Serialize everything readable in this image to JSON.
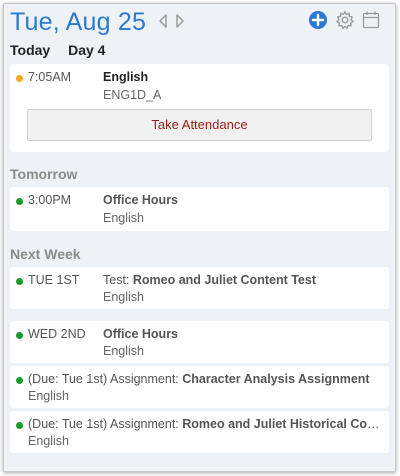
{
  "header": {
    "date_title": "Tue, Aug 25",
    "colors": {
      "accent": "#2a7bd1",
      "icon_gray": "#9a9a9a"
    }
  },
  "today": {
    "label": "Today",
    "day_label": "Day 4",
    "event": {
      "dot_color": "#f5a623",
      "time": "7:05AM",
      "title": "English",
      "subtitle": "ENG1D_A",
      "action_label": "Take Attendance"
    }
  },
  "tomorrow": {
    "label": "Tomorrow",
    "event": {
      "dot_color": "#1a9a2c",
      "time": "3:00PM",
      "title": "Office Hours",
      "subtitle": "English"
    }
  },
  "next_week": {
    "label": "Next Week",
    "events": [
      {
        "dot_color": "#1a9a2c",
        "time": "TUE 1ST",
        "prefix": "Test: ",
        "title": "Romeo and Juliet Content Test",
        "subtitle": "English"
      },
      {
        "dot_color": "#1a9a2c",
        "time": "WED 2ND",
        "prefix": "",
        "title": "Office Hours",
        "subtitle": "English"
      },
      {
        "dot_color": "#1a9a2c",
        "prefix": "(Due: Tue 1st) Assignment: ",
        "title": "Character Analysis Assignment",
        "subtitle": "English"
      },
      {
        "dot_color": "#1a9a2c",
        "prefix": "(Due: Tue 1st) Assignment: ",
        "title": "Romeo and Juliet Historical Context",
        "subtitle": "English"
      }
    ]
  }
}
